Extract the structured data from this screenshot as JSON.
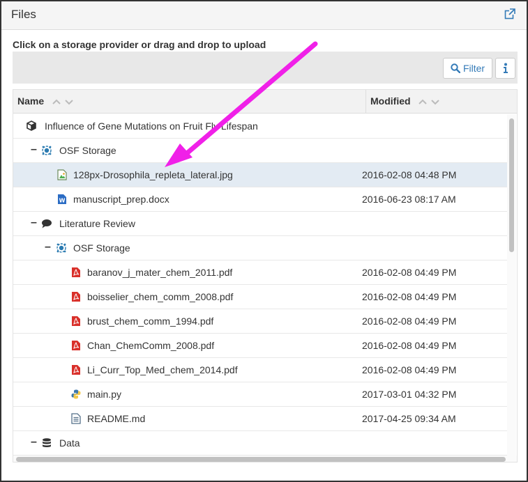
{
  "panel": {
    "title": "Files",
    "external_link_icon": "external-link-icon"
  },
  "hint": "Click on a storage provider or drag and drop to upload",
  "toolbar": {
    "filter_label": "Filter",
    "filter_icon": "search-icon",
    "info_icon": "info-icon"
  },
  "columns": {
    "name": "Name",
    "modified": "Modified"
  },
  "rows": [
    {
      "label": "Influence of Gene Mutations on Fruit Fly Lifespan",
      "date": "",
      "icon": "project-cube-icon",
      "toggle": ""
    },
    {
      "label": "OSF Storage",
      "date": "",
      "icon": "osf-storage-icon",
      "toggle": "–"
    },
    {
      "label": "128px-Drosophila_repleta_lateral.jpg",
      "date": "2016-02-08 04:48 PM",
      "icon": "image-file-icon",
      "toggle": ""
    },
    {
      "label": "manuscript_prep.docx",
      "date": "2016-06-23 08:17 AM",
      "icon": "word-file-icon",
      "toggle": ""
    },
    {
      "label": "Literature Review",
      "date": "",
      "icon": "comment-icon",
      "toggle": "–"
    },
    {
      "label": "OSF Storage",
      "date": "",
      "icon": "osf-storage-icon",
      "toggle": "–"
    },
    {
      "label": "baranov_j_mater_chem_2011.pdf",
      "date": "2016-02-08 04:49 PM",
      "icon": "pdf-file-icon",
      "toggle": ""
    },
    {
      "label": "boisselier_chem_comm_2008.pdf",
      "date": "2016-02-08 04:49 PM",
      "icon": "pdf-file-icon",
      "toggle": ""
    },
    {
      "label": "brust_chem_comm_1994.pdf",
      "date": "2016-02-08 04:49 PM",
      "icon": "pdf-file-icon",
      "toggle": ""
    },
    {
      "label": "Chan_ChemComm_2008.pdf",
      "date": "2016-02-08 04:49 PM",
      "icon": "pdf-file-icon",
      "toggle": ""
    },
    {
      "label": "Li_Curr_Top_Med_chem_2014.pdf",
      "date": "2016-02-08 04:49 PM",
      "icon": "pdf-file-icon",
      "toggle": ""
    },
    {
      "label": "main.py",
      "date": "2017-03-01 04:32 PM",
      "icon": "python-file-icon",
      "toggle": ""
    },
    {
      "label": "README.md",
      "date": "2017-04-25 09:34 AM",
      "icon": "text-file-icon",
      "toggle": ""
    },
    {
      "label": "Data",
      "date": "",
      "icon": "database-icon",
      "toggle": "–"
    }
  ],
  "annotation_arrow_color": "#f020e8",
  "colors": {
    "link": "#337ab7",
    "selected_row": "#e3ebf3",
    "pdf": "#d9302a"
  }
}
